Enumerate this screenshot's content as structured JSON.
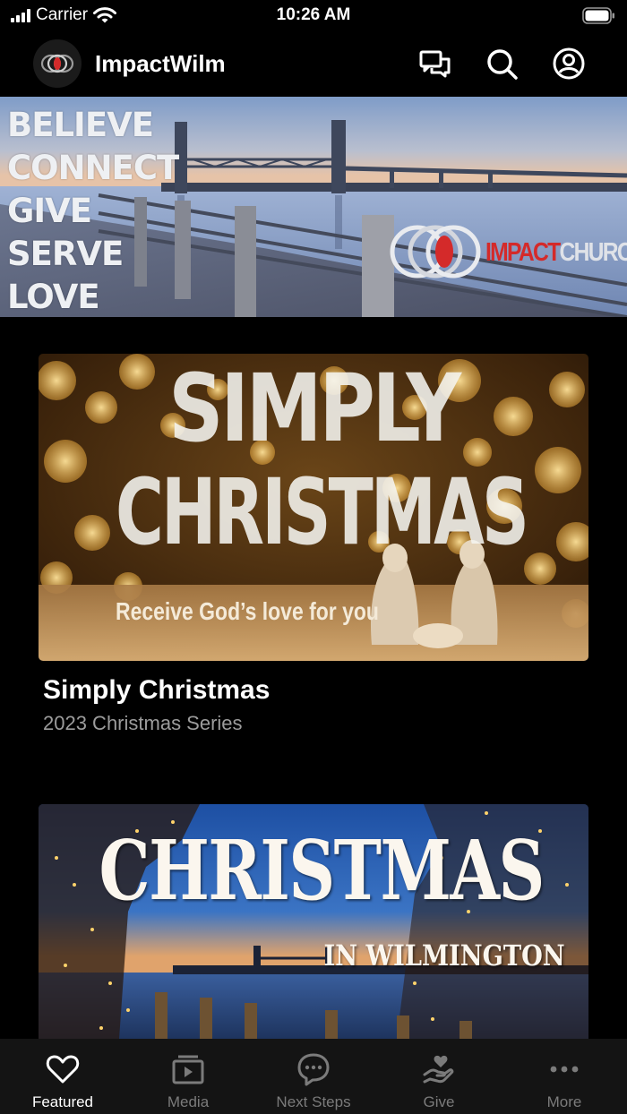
{
  "status_bar": {
    "carrier": "Carrier",
    "time": "10:26 AM"
  },
  "header": {
    "title": "ImpactWilm"
  },
  "hero": {
    "words": [
      "BELIEVE",
      "CONNECT",
      "GIVE",
      "SERVE",
      "LOVE"
    ],
    "brand_impact": "IMPACT",
    "brand_church": "CHURCH"
  },
  "cards": [
    {
      "art_line1": "SIMPLY",
      "art_line2": "CHRISTMAS",
      "art_tagline": "Receive God’s love for you",
      "title": "Simply Christmas",
      "subtitle": "2023 Christmas Series"
    },
    {
      "art_line1": "CHRISTMAS",
      "art_line2": "IN WILMINGTON"
    }
  ],
  "tabs": [
    {
      "label": "Featured",
      "icon": "heart-icon",
      "active": true
    },
    {
      "label": "Media",
      "icon": "media-play-icon",
      "active": false
    },
    {
      "label": "Next Steps",
      "icon": "chat-bubble-icon",
      "active": false
    },
    {
      "label": "Give",
      "icon": "give-hand-heart-icon",
      "active": false
    },
    {
      "label": "More",
      "icon": "more-dots-icon",
      "active": false
    }
  ],
  "colors": {
    "background": "#000000",
    "tabbar": "#141414",
    "inactive_tab": "#7b7b7b",
    "brand_red": "#d42a2a"
  }
}
